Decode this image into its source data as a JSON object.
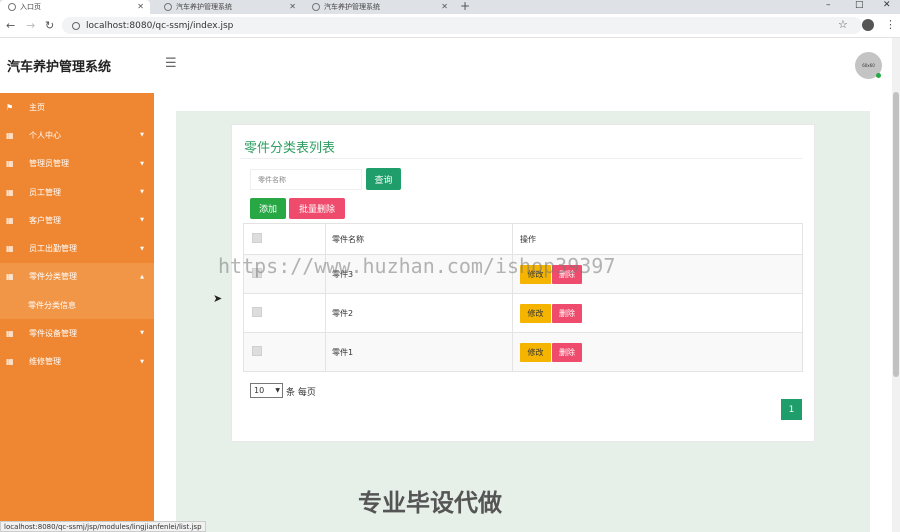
{
  "browser": {
    "tabs": [
      {
        "label": "入口页",
        "active": true
      },
      {
        "label": "汽车养护管理系统",
        "active": false
      },
      {
        "label": "汽车养护管理系统",
        "active": false
      }
    ],
    "new_tab": "+",
    "url": "localhost:8080/qc-ssmj/index.jsp",
    "status_url": "localhost:8080/qc-ssmj/jsp/modules/lingjianfenlei/list.jsp"
  },
  "header": {
    "app_title": "汽车养护管理系统",
    "avatar_text": "60x60"
  },
  "sidebar": {
    "items": [
      {
        "label": "主页",
        "icon": "flag-icon"
      },
      {
        "label": "个人中心",
        "icon": "table-icon"
      },
      {
        "label": "管理员管理",
        "icon": "table-icon"
      },
      {
        "label": "员工管理",
        "icon": "table-icon"
      },
      {
        "label": "客户管理",
        "icon": "table-icon"
      },
      {
        "label": "员工出勤管理",
        "icon": "table-icon"
      },
      {
        "label": "零件分类管理",
        "icon": "table-icon",
        "open": true
      },
      {
        "label": "零件设备管理",
        "icon": "table-icon"
      },
      {
        "label": "维修管理",
        "icon": "table-icon"
      }
    ],
    "sub_item": "零件分类信息"
  },
  "main": {
    "panel_title": "零件分类表列表",
    "search_placeholder": "零件名称",
    "search_button": "查询",
    "add_button": "添加",
    "batch_delete_button": "批量删除",
    "table": {
      "headers": [
        "",
        "零件名称",
        "操作"
      ],
      "rows": [
        {
          "name": "零件3"
        },
        {
          "name": "零件2"
        },
        {
          "name": "零件1"
        }
      ],
      "edit_label": "修改",
      "delete_label": "删除"
    },
    "page_size": "10",
    "page_size_label": "条 每页",
    "current_page": "1"
  },
  "watermarks": {
    "url": "https://www.huzhan.com/ishop39397",
    "text": "专业毕设代做"
  },
  "colors": {
    "sidebar": "#ef8732",
    "accent_green": "#1f9d6a",
    "danger": "#ef4b6c",
    "warning": "#f4b400"
  }
}
